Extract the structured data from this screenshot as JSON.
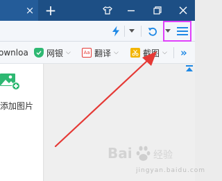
{
  "titlebar": {
    "tab_close": "×",
    "new_tab": "+"
  },
  "bookmarks": {
    "partial_item": "ownloa",
    "items": [
      {
        "label": "网银",
        "icon": "shield-icon"
      },
      {
        "label": "翻译",
        "icon": "translate-icon"
      },
      {
        "label": "截图",
        "icon": "scissors-icon"
      }
    ],
    "more": "»"
  },
  "sidebar": {
    "add_image_label": "添加图片"
  },
  "watermark": {
    "text": "jingyan.baidu.com"
  },
  "colors": {
    "titlebar": "#1d4f85",
    "accent": "#1e88e5",
    "highlight_box": "#e040fb",
    "arrow": "#e53935",
    "add_image_green": "#2eb872"
  }
}
